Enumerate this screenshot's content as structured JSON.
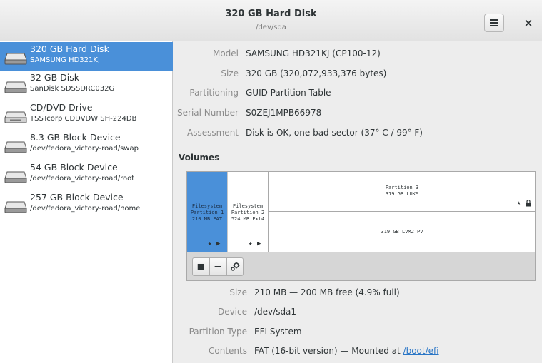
{
  "header": {
    "title": "320 GB Hard Disk",
    "subtitle": "/dev/sda",
    "menu_icon": "hamburger-menu-icon",
    "close_glyph": "×"
  },
  "sidebar": {
    "items": [
      {
        "name": "320 GB Hard Disk",
        "sub": "SAMSUNG HD321KJ",
        "icon": "hard-disk-icon",
        "selected": true
      },
      {
        "name": "32 GB Disk",
        "sub": "SanDisk SDSSDRC032G",
        "icon": "hard-disk-icon",
        "selected": false
      },
      {
        "name": "CD/DVD Drive",
        "sub": "TSSTcorp CDDVDW SH-224DB",
        "icon": "optical-drive-icon",
        "selected": false
      },
      {
        "name": "8.3 GB Block Device",
        "sub": "/dev/fedora_victory-road/swap",
        "icon": "hard-disk-icon",
        "selected": false
      },
      {
        "name": "54 GB Block Device",
        "sub": "/dev/fedora_victory-road/root",
        "icon": "hard-disk-icon",
        "selected": false
      },
      {
        "name": "257 GB Block Device",
        "sub": "/dev/fedora_victory-road/home",
        "icon": "hard-disk-icon",
        "selected": false
      }
    ]
  },
  "disk": {
    "model_label": "Model",
    "model": "SAMSUNG HD321KJ (CP100-12)",
    "size_label": "Size",
    "size": "320 GB (320,072,933,376 bytes)",
    "partitioning_label": "Partitioning",
    "partitioning": "GUID Partition Table",
    "serial_label": "Serial Number",
    "serial": "S0ZEJ1MPB66978",
    "assessment_label": "Assessment",
    "assessment": "Disk is OK, one bad sector (37° C / 99° F)"
  },
  "volumes": {
    "heading": "Volumes",
    "partitions": [
      {
        "line1": "Filesystem",
        "line2": "Partition 1",
        "line3": "210 MB FAT",
        "selected": true
      },
      {
        "line1": "Filesystem",
        "line2": "Partition 2",
        "line3": "524 MB Ext4",
        "selected": false
      },
      {
        "line1": "Partition 3",
        "line2": "319 GB LUKS",
        "selected": false
      }
    ],
    "lvm": "319 GB LVM2 PV",
    "toolbar": {
      "stop_glyph": "■",
      "minus_glyph": "−",
      "settings_icon": "gears-icon"
    }
  },
  "volume_details": {
    "size_label": "Size",
    "size": "210 MB — 200 MB free (4.9% full)",
    "device_label": "Device",
    "device": "/dev/sda1",
    "ptype_label": "Partition Type",
    "ptype": "EFI System",
    "contents_label": "Contents",
    "contents_prefix": "FAT (16-bit version) — Mounted at ",
    "contents_link": "/boot/efi"
  },
  "colors": {
    "selection": "#4a90d9",
    "link": "#2a76c6"
  }
}
